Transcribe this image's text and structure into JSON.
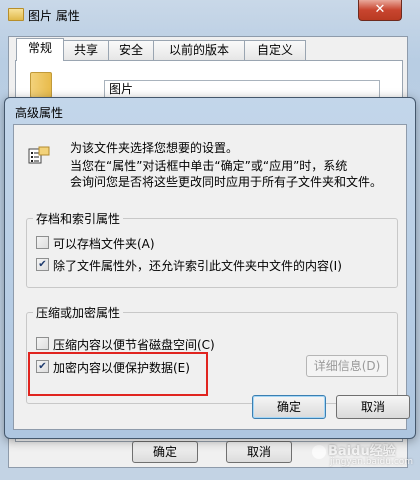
{
  "parent_window": {
    "title": "图片 属性",
    "close_glyph": "✕",
    "tabs": [
      {
        "label": "常规",
        "active": true
      },
      {
        "label": "共享",
        "active": false
      },
      {
        "label": "安全",
        "active": false
      },
      {
        "label": "以前的版本",
        "active": false
      },
      {
        "label": "自定义",
        "active": false
      }
    ],
    "folder_name": "图片",
    "ok_label": "确定",
    "cancel_label": "取消"
  },
  "dialog": {
    "title": "高级属性",
    "icon": "folder-attributes-icon",
    "info_lines": [
      "为该文件夹选择您想要的设置。",
      "当您在“属性”对话框中单击“确定”或“应用”时，系统",
      "会询问您是否将这些更改同时应用于所有子文件夹和文件。"
    ],
    "archive_group": {
      "legend": "存档和索引属性",
      "options": [
        {
          "label": "可以存档文件夹(A)",
          "checked": false
        },
        {
          "label": "除了文件属性外，还允许索引此文件夹中文件的内容(I)",
          "checked": true
        }
      ]
    },
    "compress_group": {
      "legend": "压缩或加密属性",
      "options": [
        {
          "label": "压缩内容以便节省磁盘空间(C)",
          "checked": false
        },
        {
          "label": "加密内容以便保护数据(E)",
          "checked": true
        }
      ],
      "details_label": "详细信息(D)",
      "details_enabled": false
    },
    "ok_label": "确定",
    "cancel_label": "取消"
  },
  "check_glyph": "✔",
  "annotation": {
    "color": "#e0241f",
    "target": "加密内容以便保护数据(E)"
  },
  "watermark": {
    "brand": "Baidu经验",
    "url": "jingyan.baidu.com"
  }
}
